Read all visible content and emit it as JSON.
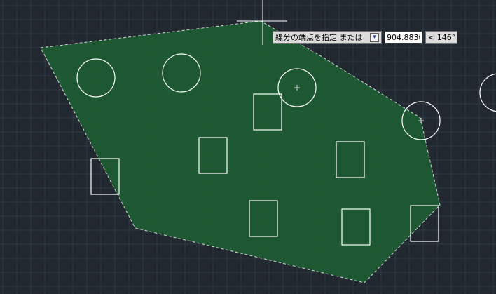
{
  "canvas": {
    "background_color": "#212830",
    "grid_color": "#2f3844",
    "hatch_fill_color": "#1e5c34",
    "entity_color": "#ffffff",
    "crosshair_color": "#ffffff"
  },
  "dynamic_input": {
    "prompt": "線分の端点を指定 または",
    "dropdown_icon": "down-arrow-icon",
    "length_value": "904.8830",
    "angle_value": "< 146°"
  }
}
